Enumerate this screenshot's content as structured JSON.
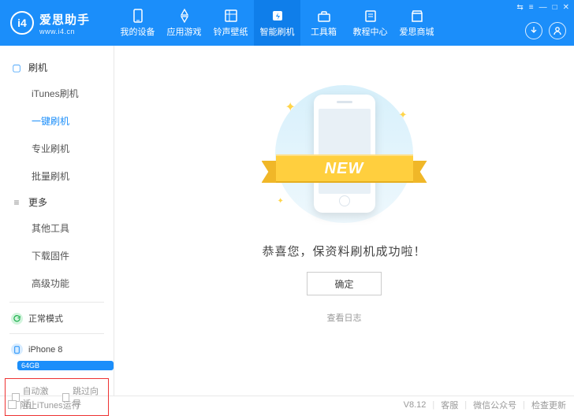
{
  "logo": {
    "icon_text": "i4",
    "cn": "爱思助手",
    "en": "www.i4.cn"
  },
  "nav": [
    {
      "label": "我的设备",
      "icon": "phone"
    },
    {
      "label": "应用游戏",
      "icon": "app"
    },
    {
      "label": "铃声壁纸",
      "icon": "media"
    },
    {
      "label": "智能刷机",
      "icon": "flash",
      "active": true
    },
    {
      "label": "工具箱",
      "icon": "toolbox"
    },
    {
      "label": "教程中心",
      "icon": "book"
    },
    {
      "label": "爱思商城",
      "icon": "store"
    }
  ],
  "window_controls": [
    "⇆",
    "≡",
    "—",
    "□",
    "✕"
  ],
  "sidebar": {
    "groups": [
      {
        "title": "刷机",
        "icon": "▢",
        "items": [
          {
            "label": "iTunes刷机"
          },
          {
            "label": "一键刷机",
            "active": true
          },
          {
            "label": "专业刷机"
          },
          {
            "label": "批量刷机"
          }
        ]
      },
      {
        "title": "更多",
        "icon": "≡",
        "cls": "more",
        "items": [
          {
            "label": "其他工具"
          },
          {
            "label": "下载固件"
          },
          {
            "label": "高级功能"
          }
        ]
      }
    ],
    "mode": {
      "label": "正常模式"
    },
    "device": {
      "name": "iPhone 8",
      "storage": "64GB"
    },
    "options": {
      "auto_activate": "自动激活",
      "skip_guide": "跳过向导"
    }
  },
  "content": {
    "ribbon_text": "NEW",
    "success_msg": "恭喜您，保资料刷机成功啦！",
    "ok_label": "确定",
    "view_log": "查看日志"
  },
  "footer": {
    "block_itunes": "阻止iTunes运行",
    "version": "V8.12",
    "links": [
      "客服",
      "微信公众号",
      "检查更新"
    ]
  }
}
